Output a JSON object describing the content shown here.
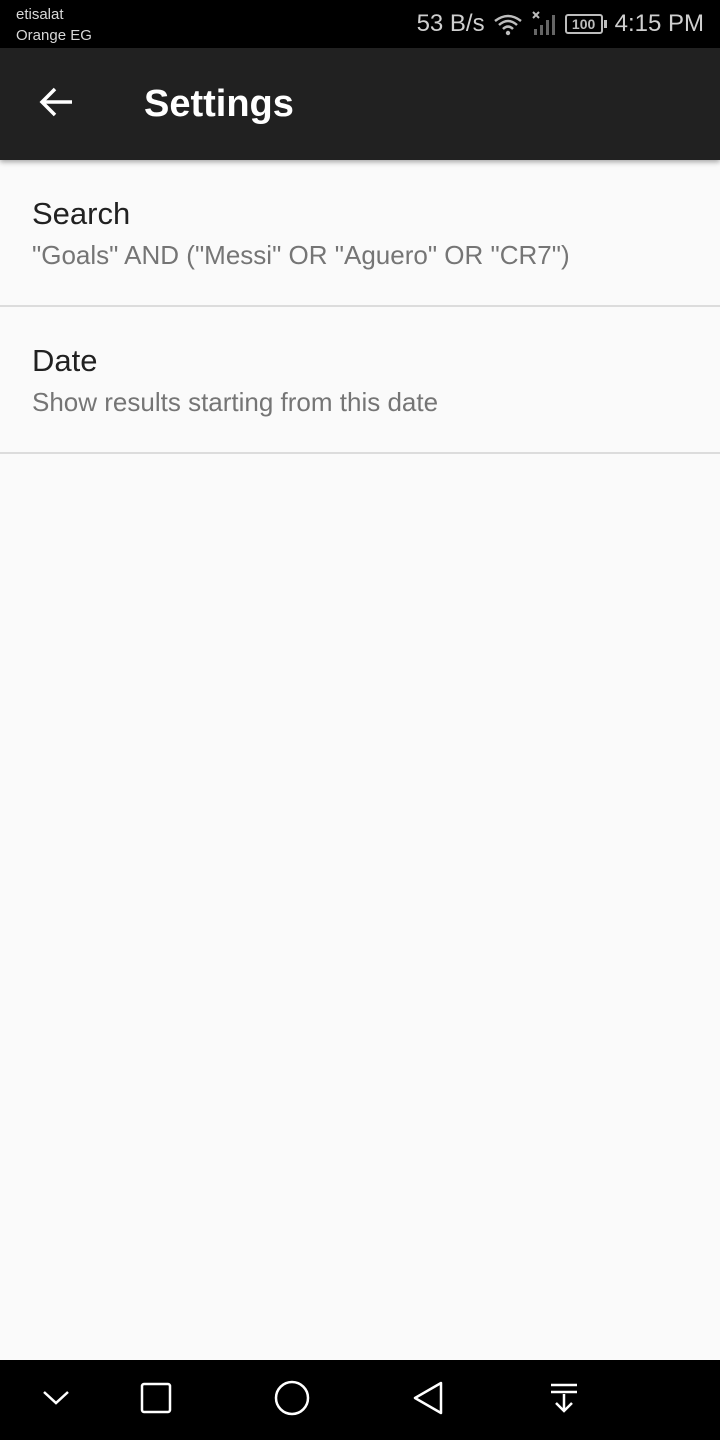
{
  "status_bar": {
    "carrier_line1": "etisalat",
    "carrier_line2": "Orange EG",
    "net_speed": "53 B/s",
    "battery": "100",
    "time": "4:15 PM",
    "icons": [
      "wifi-icon",
      "no-signal-icon",
      "battery-icon"
    ]
  },
  "app_bar": {
    "title": "Settings",
    "back_icon": "arrow-back-icon",
    "background_color": "#212121"
  },
  "preferences": [
    {
      "title": "Search",
      "summary": "\"Goals\" AND (\"Messi\" OR \"Aguero\" OR \"CR7\")"
    },
    {
      "title": "Date",
      "summary": "Show results starting from this date"
    }
  ],
  "nav_bar": {
    "buttons": [
      "hide-nav-icon",
      "recents-icon",
      "home-icon",
      "back-icon",
      "notification-pull-icon"
    ]
  }
}
